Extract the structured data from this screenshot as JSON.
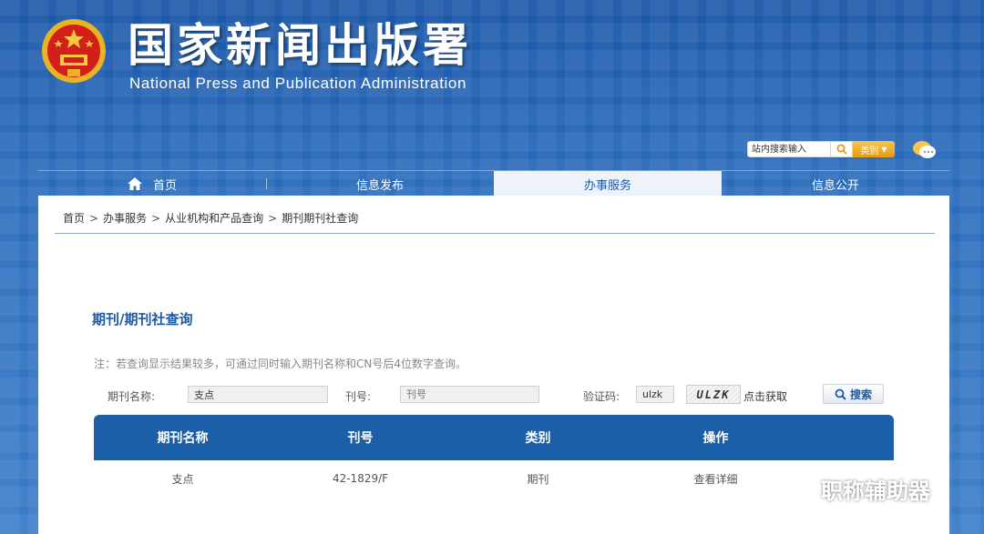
{
  "header": {
    "title": "国家新闻出版署",
    "subtitle": "National Press and Publication Administration",
    "search_placeholder": "站内搜索输入",
    "category_label": "类别"
  },
  "nav": {
    "items": [
      {
        "label": "首页"
      },
      {
        "label": "信息发布"
      },
      {
        "label": "办事服务"
      },
      {
        "label": "信息公开"
      }
    ],
    "active": "办事服务"
  },
  "breadcrumb": [
    "首页",
    "办事服务",
    "从业机构和产品查询",
    "期刊期刊社查询"
  ],
  "page": {
    "section_title": "期刊/期刊社查询",
    "note": "注：若查询显示结果较多，可通过同时输入期刊名称和CN号后4位数字查询。"
  },
  "form": {
    "name_label": "期刊名称:",
    "name_value": "支点",
    "issue_label": "刊号:",
    "issue_placeholder": "刊号",
    "captcha_label": "验证码:",
    "captcha_value": "ulzk",
    "captcha_image_text": "ULZK",
    "refresh_label": "点击获取",
    "search_label": "搜索"
  },
  "results": {
    "columns": [
      "期刊名称",
      "刊号",
      "类别",
      "操作"
    ],
    "rows": [
      {
        "name": "支点",
        "issue": "42-1829/F",
        "category": "期刊",
        "action": "查看详细"
      }
    ]
  },
  "watermark": "职称辅助器",
  "colors": {
    "brand_blue": "#1b5fa8",
    "accent_gold": "#e59c14"
  }
}
